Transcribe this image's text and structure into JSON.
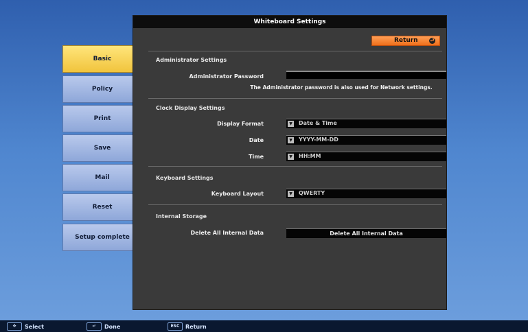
{
  "window": {
    "title": "Whiteboard Settings"
  },
  "toolbar": {
    "return_label": "Return"
  },
  "sidebar": {
    "tabs": [
      {
        "label": "Basic",
        "active": true
      },
      {
        "label": "Policy",
        "active": false
      },
      {
        "label": "Print",
        "active": false
      },
      {
        "label": "Save",
        "active": false
      },
      {
        "label": "Mail",
        "active": false
      },
      {
        "label": "Reset",
        "active": false
      },
      {
        "label": "Setup complete",
        "active": false
      }
    ]
  },
  "sections": {
    "admin": {
      "title": "Administrator Settings",
      "password_label": "Administrator Password",
      "password_value": "",
      "note": "The Administrator password is also used for Network settings."
    },
    "clock": {
      "title": "Clock Display Settings",
      "display_format_label": "Display Format",
      "display_format_value": "Date & Time",
      "date_label": "Date",
      "date_value": "YYYY-MM-DD",
      "time_label": "Time",
      "time_value": "HH:MM"
    },
    "keyboard": {
      "title": "Keyboard Settings",
      "layout_label": "Keyboard Layout",
      "layout_value": "QWERTY"
    },
    "storage": {
      "title": "Internal Storage",
      "delete_label": "Delete All Internal Data",
      "delete_button": "Delete All Internal Data"
    }
  },
  "footer": {
    "select_label": "Select",
    "done_label": "Done",
    "return_label": "Return"
  },
  "colors": {
    "background": "#4f86cf",
    "panel": "#3a3a3a",
    "title_bar": "#0d0d0d",
    "return_button": "#ef6f1a",
    "active_tab": "#f1c43d",
    "inactive_tab": "#8ea7d9"
  },
  "icons": {
    "return": "return-icon",
    "dropdown": "chevron-down-icon",
    "select": "dpad-icon",
    "done": "enter-key-icon",
    "esc": "esc-key-icon"
  }
}
